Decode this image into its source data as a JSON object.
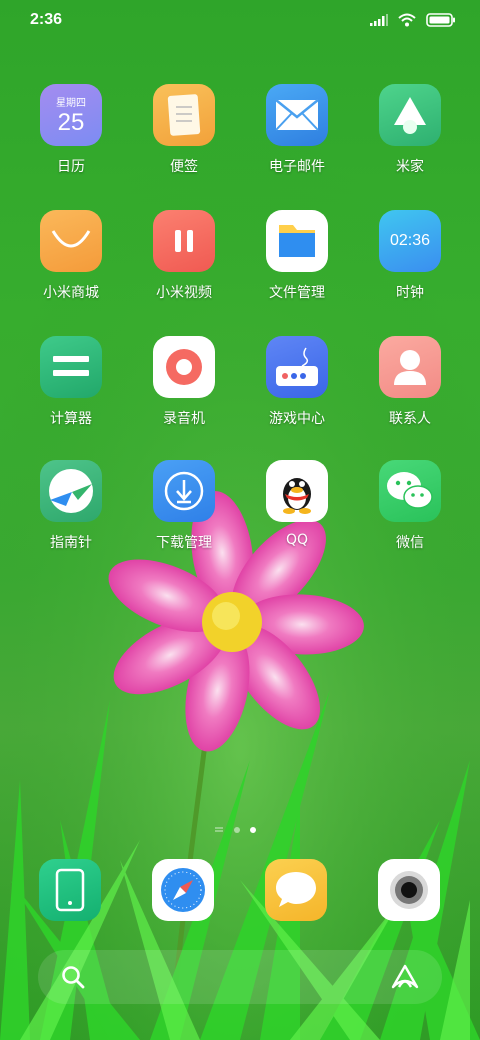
{
  "status_bar": {
    "time": "2:36"
  },
  "apps": [
    {
      "name": "日历",
      "icon": "calendar-icon",
      "weekday": "星期四",
      "day": "25"
    },
    {
      "name": "便签",
      "icon": "notes-icon"
    },
    {
      "name": "电子邮件",
      "icon": "mail-icon"
    },
    {
      "name": "米家",
      "icon": "mijia-icon"
    },
    {
      "name": "小米商城",
      "icon": "mi-store-icon"
    },
    {
      "name": "小米视频",
      "icon": "mi-video-icon"
    },
    {
      "name": "文件管理",
      "icon": "file-manager-icon"
    },
    {
      "name": "时钟",
      "icon": "clock-icon",
      "clock_text": "02:36"
    },
    {
      "name": "计算器",
      "icon": "calculator-icon"
    },
    {
      "name": "录音机",
      "icon": "recorder-icon"
    },
    {
      "name": "游戏中心",
      "icon": "game-center-icon"
    },
    {
      "name": "联系人",
      "icon": "contacts-icon"
    },
    {
      "name": "指南针",
      "icon": "compass-icon"
    },
    {
      "name": "下载管理",
      "icon": "download-icon"
    },
    {
      "name": "QQ",
      "icon": "qq-icon"
    },
    {
      "name": "微信",
      "icon": "wechat-icon"
    }
  ],
  "dock": [
    {
      "icon": "phone-icon"
    },
    {
      "icon": "browser-icon"
    },
    {
      "icon": "messages-icon"
    },
    {
      "icon": "camera-icon"
    }
  ],
  "page_indicator": {
    "pages": 2,
    "current": 2
  }
}
